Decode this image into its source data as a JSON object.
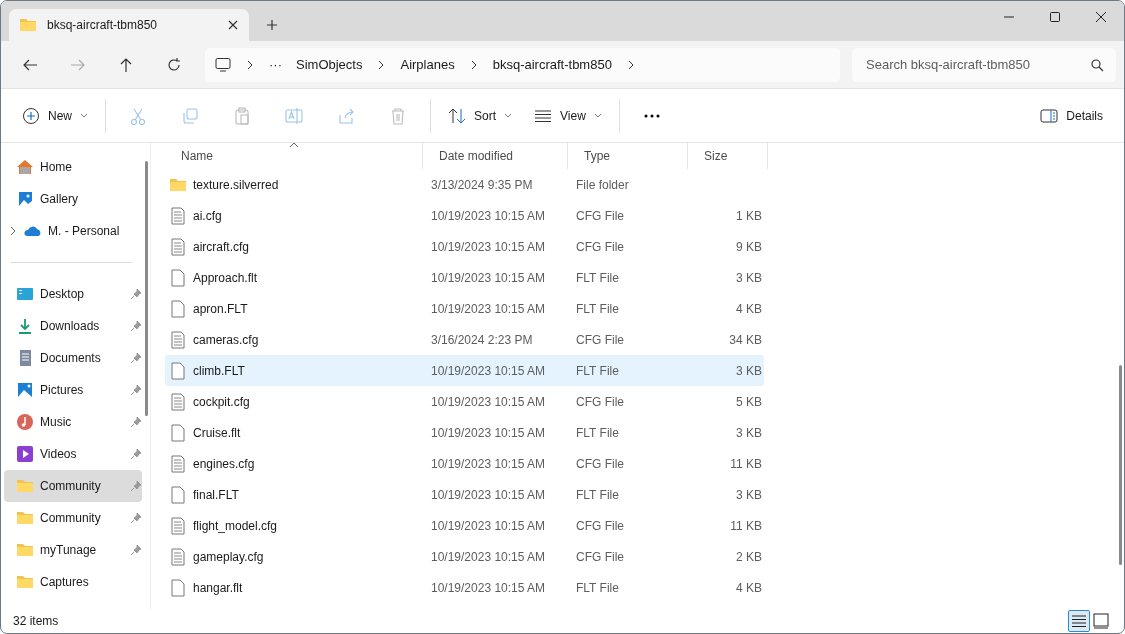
{
  "tab": {
    "title": "bksq-aircraft-tbm850"
  },
  "address": {
    "overflow": "···",
    "crumbs": [
      "SimObjects",
      "Airplanes",
      "bksq-aircraft-tbm850"
    ]
  },
  "search": {
    "placeholder": "Search bksq-aircraft-tbm850"
  },
  "toolbar": {
    "new": "New",
    "actions": [
      {
        "kind": "cut",
        "disabled": true
      },
      {
        "kind": "copy",
        "disabled": true
      },
      {
        "kind": "paste",
        "disabled": true
      },
      {
        "kind": "rename",
        "disabled": true
      },
      {
        "kind": "share",
        "disabled": true
      },
      {
        "kind": "delete",
        "disabled": true
      }
    ],
    "sort": "Sort",
    "view": "View",
    "details": "Details"
  },
  "sidebar": {
    "top": [
      {
        "label": "Home",
        "kind": "home",
        "selected": false
      },
      {
        "label": "Gallery",
        "kind": "gallery",
        "selected": false
      },
      {
        "label": "M. - Personal",
        "kind": "cloud",
        "selected": false,
        "expanded": false
      }
    ],
    "pinned": [
      {
        "label": "Desktop",
        "kind": "desktop",
        "selected": false,
        "pinned": true
      },
      {
        "label": "Downloads",
        "kind": "downloads",
        "selected": false,
        "pinned": true
      },
      {
        "label": "Documents",
        "kind": "documents",
        "selected": false,
        "pinned": true
      },
      {
        "label": "Pictures",
        "kind": "pictures",
        "selected": false,
        "pinned": true
      },
      {
        "label": "Music",
        "kind": "music",
        "selected": false,
        "pinned": true
      },
      {
        "label": "Videos",
        "kind": "videos",
        "selected": false,
        "pinned": true
      },
      {
        "label": "Community",
        "kind": "folder",
        "selected": true,
        "pinned": true
      },
      {
        "label": "Community",
        "kind": "folder",
        "selected": false,
        "pinned": true
      },
      {
        "label": "myTunage",
        "kind": "folder",
        "selected": false,
        "pinned": true
      },
      {
        "label": "Captures",
        "kind": "folder",
        "selected": false,
        "pinned": false
      }
    ]
  },
  "table": {
    "columns": [
      {
        "label": "Name",
        "sorted": true
      },
      {
        "label": "Date modified",
        "sorted": false
      },
      {
        "label": "Type",
        "sorted": false
      },
      {
        "label": "Size",
        "sorted": false
      }
    ],
    "rows": [
      {
        "kind": "folder",
        "name": "texture.silverred",
        "date": "3/13/2024 9:35 PM",
        "type": "File folder",
        "selected": false
      },
      {
        "kind": "config",
        "name": "ai.cfg",
        "date": "10/19/2023 10:15 AM",
        "type": "CFG File",
        "size": "1 KB",
        "selected": false
      },
      {
        "kind": "config",
        "name": "aircraft.cfg",
        "date": "10/19/2023 10:15 AM",
        "type": "CFG File",
        "size": "9 KB",
        "selected": false
      },
      {
        "kind": "file",
        "name": "Approach.flt",
        "date": "10/19/2023 10:15 AM",
        "type": "FLT File",
        "size": "3 KB",
        "selected": false
      },
      {
        "kind": "file",
        "name": "apron.FLT",
        "date": "10/19/2023 10:15 AM",
        "type": "FLT File",
        "size": "4 KB",
        "selected": false
      },
      {
        "kind": "config",
        "name": "cameras.cfg",
        "date": "3/16/2024 2:23 PM",
        "type": "CFG File",
        "size": "34 KB",
        "selected": false
      },
      {
        "kind": "file",
        "name": "climb.FLT",
        "date": "10/19/2023 10:15 AM",
        "type": "FLT File",
        "size": "3 KB",
        "selected": true
      },
      {
        "kind": "config",
        "name": "cockpit.cfg",
        "date": "10/19/2023 10:15 AM",
        "type": "CFG File",
        "size": "5 KB",
        "selected": false
      },
      {
        "kind": "file",
        "name": "Cruise.flt",
        "date": "10/19/2023 10:15 AM",
        "type": "FLT File",
        "size": "3 KB",
        "selected": false
      },
      {
        "kind": "config",
        "name": "engines.cfg",
        "date": "10/19/2023 10:15 AM",
        "type": "CFG File",
        "size": "11 KB",
        "selected": false
      },
      {
        "kind": "file",
        "name": "final.FLT",
        "date": "10/19/2023 10:15 AM",
        "type": "FLT File",
        "size": "3 KB",
        "selected": false
      },
      {
        "kind": "config",
        "name": "flight_model.cfg",
        "date": "10/19/2023 10:15 AM",
        "type": "CFG File",
        "size": "11 KB",
        "selected": false
      },
      {
        "kind": "config",
        "name": "gameplay.cfg",
        "date": "10/19/2023 10:15 AM",
        "type": "CFG File",
        "size": "2 KB",
        "selected": false
      },
      {
        "kind": "file",
        "name": "hangar.flt",
        "date": "10/19/2023 10:15 AM",
        "type": "FLT File",
        "size": "4 KB",
        "selected": false
      }
    ]
  },
  "status": {
    "count": "32 items",
    "views": [
      {
        "kind": "details",
        "selected": true
      },
      {
        "kind": "tiles",
        "selected": false
      }
    ]
  }
}
